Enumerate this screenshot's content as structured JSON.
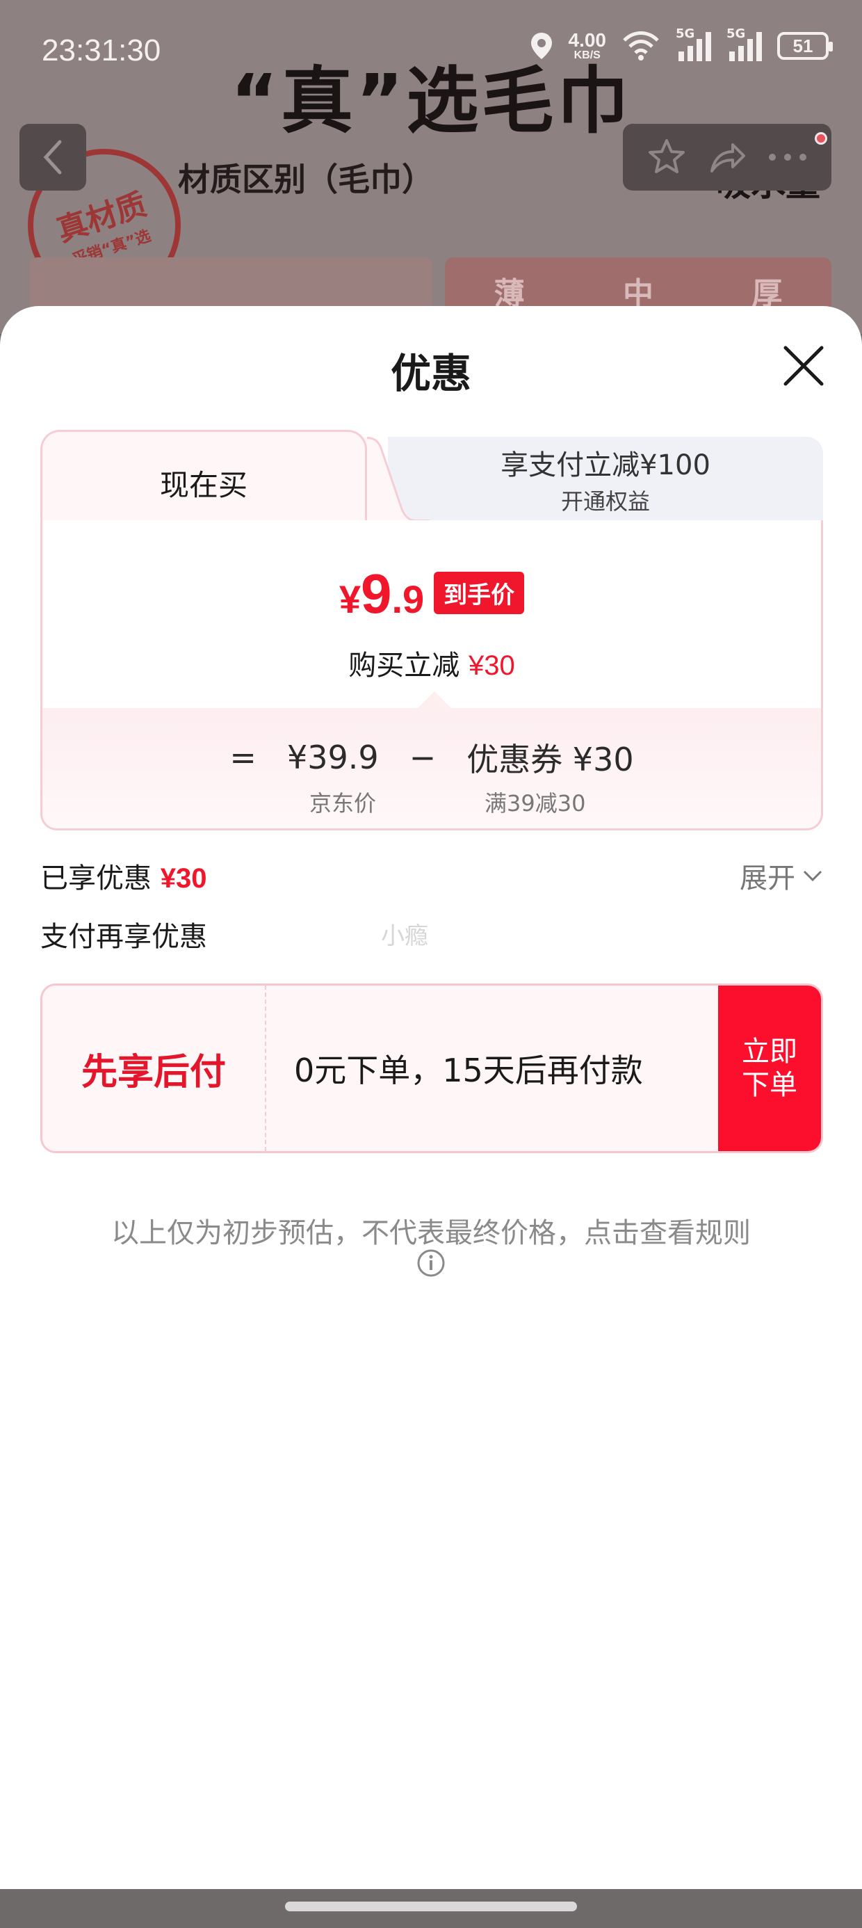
{
  "status_bar": {
    "time": "23:31:30",
    "net_speed_value": "4.00",
    "net_speed_unit": "KB/S",
    "sim1_tag": "5G",
    "sim2_tag": "5G",
    "battery": "51"
  },
  "background_page": {
    "headline": "“真”选毛巾",
    "section_title": "材质区别（毛巾）",
    "right_label": "吸水量",
    "stamp_line1": "真材质",
    "stamp_line2": "采销“真”选",
    "thickness_tabs": [
      "薄",
      "中",
      "厚"
    ]
  },
  "sheet": {
    "title": "优惠",
    "tabs": {
      "active_label": "现在买",
      "other_line1": "享支付立减¥100",
      "other_line2": "开通权益"
    },
    "price": {
      "currency": "¥",
      "integer": "9",
      "decimal": ".9",
      "badge": "到手价"
    },
    "reduce": {
      "label": "购买立减",
      "amount": "¥30"
    },
    "calc": {
      "equals": "=",
      "base_price": "¥39.9",
      "minus": "−",
      "coupon_label": "优惠券 ¥30",
      "base_sub": "京东价",
      "coupon_sub": "满39减30"
    },
    "enjoyed": {
      "label": "已享优惠",
      "amount": "¥30",
      "expand": "展开"
    },
    "pay_more_label": "支付再享优惠",
    "watermark": "小瘾",
    "bnpl": {
      "title": "先享后付",
      "description": "0元下单，15天后再付款",
      "button_line1": "立即",
      "button_line2": "下单"
    },
    "disclaimer": "以上仅为初步预估，不代表最终价格，点击查看规则"
  },
  "colors": {
    "accent_red": "#f0172c",
    "button_red": "#fc0f2c",
    "card_border": "#f6cdd4"
  }
}
